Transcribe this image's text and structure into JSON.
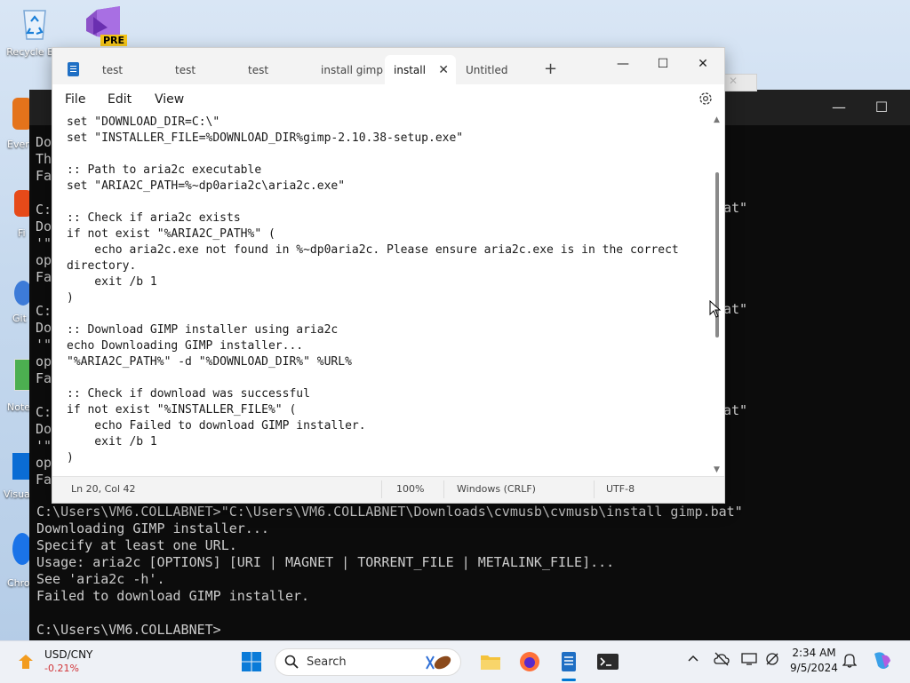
{
  "desktop": {
    "icons": [
      {
        "label": "Recycle Bin",
        "icon": "recycle-bin-icon"
      },
      {
        "label": "PRE",
        "icon": "visual-studio-preview-icon"
      }
    ],
    "partial_labels": [
      "Ever",
      "Fi",
      "Git",
      "Note",
      "Visua",
      "Chro"
    ]
  },
  "terminal": {
    "bg_left_fragments": [
      "Do",
      "Th",
      "Fa",
      "C:",
      "Do",
      "'\"",
      "op",
      "Fa",
      "C:",
      "Do",
      "'\"",
      "op",
      "Fa",
      "C:",
      "Do",
      "'\"",
      "op",
      "Fa",
      "C:",
      "Do",
      "'\"",
      "op",
      "Fa"
    ],
    "right_fragments": [
      "at\"",
      "at\"",
      "at\""
    ],
    "lines": [
      "C:\\Users\\VM6.COLLABNET>\"C:\\Users\\VM6.COLLABNET\\Downloads\\cvmusb\\cvmusb\\install gimp.bat\"",
      "Downloading GIMP installer...",
      "Specify at least one URL.",
      "Usage: aria2c [OPTIONS] [URI | MAGNET | TORRENT_FILE | METALINK_FILE]...",
      "See 'aria2c -h'.",
      "Failed to download GIMP installer.",
      "",
      "C:\\Users\\VM6.COLLABNET>"
    ]
  },
  "notepad": {
    "tabs": [
      {
        "label": "test",
        "active": false
      },
      {
        "label": "test",
        "active": false
      },
      {
        "label": "test",
        "active": false
      },
      {
        "label": "install gimp",
        "active": false
      },
      {
        "label": "install",
        "active": true
      },
      {
        "label": "Untitled",
        "active": false
      }
    ],
    "new_tab": "+",
    "close_tab": "✕",
    "window_controls": {
      "minimize": "—",
      "maximize": "☐",
      "close": "✕"
    },
    "menu": [
      "File",
      "Edit",
      "View"
    ],
    "code": [
      "set \"DOWNLOAD_DIR=C:\\\"",
      "set \"INSTALLER_FILE=%DOWNLOAD_DIR%gimp-2.10.38-setup.exe\"",
      "",
      ":: Path to aria2c executable",
      "set \"ARIA2C_PATH=%~dp0aria2c\\aria2c.exe\"",
      "",
      ":: Check if aria2c exists",
      "if not exist \"%ARIA2C_PATH%\" (",
      "    echo aria2c.exe not found in %~dp0aria2c. Please ensure aria2c.exe is in the correct",
      "directory.",
      "    exit /b 1",
      ")",
      "",
      ":: Download GIMP installer using aria2c",
      "echo Downloading GIMP installer...",
      "\"%ARIA2C_PATH%\" -d \"%DOWNLOAD_DIR%\" %URL%",
      "",
      ":: Check if download was successful",
      "if not exist \"%INSTALLER_FILE%\" (",
      "    echo Failed to download GIMP installer.",
      "    exit /b 1",
      ")"
    ],
    "status": {
      "position": "Ln 20, Col 42",
      "zoom": "100%",
      "line_ending": "Windows (CRLF)",
      "encoding": "UTF-8"
    }
  },
  "taskbar": {
    "widget_title": "USD/CNY",
    "widget_value": "-0.21%",
    "widget_value_color": "#d13438",
    "search_placeholder": "Search",
    "time": "2:34 AM",
    "date": "9/5/2024",
    "accent": "#0078d4"
  }
}
